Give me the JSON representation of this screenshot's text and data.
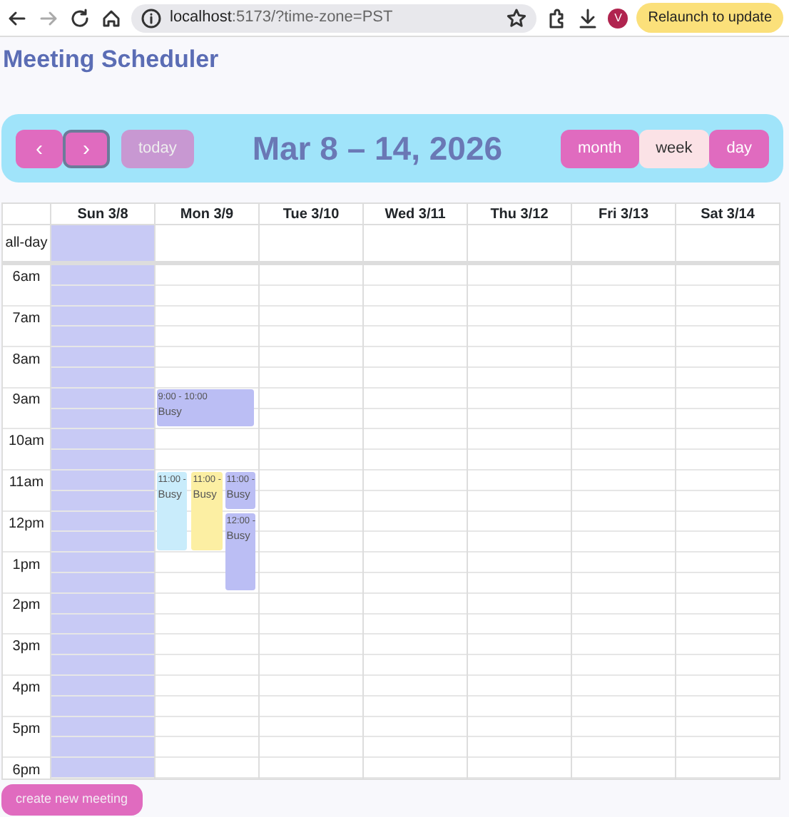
{
  "browser": {
    "url_host": "localhost",
    "url_rest": ":5173/?time-zone=PST",
    "relaunch": "Relaunch to update",
    "avatar": "V"
  },
  "app": {
    "title": "Meeting Scheduler"
  },
  "toolbar": {
    "nav": [
      {
        "label": "‹",
        "focused": false
      },
      {
        "label": "›",
        "focused": true
      }
    ],
    "today": {
      "label": "today",
      "disabled": true
    },
    "range": "Mar 8 – 14, 2026",
    "views": [
      {
        "label": "month",
        "selected": false
      },
      {
        "label": "week",
        "selected": true
      },
      {
        "label": "day",
        "selected": false
      }
    ]
  },
  "calendar": {
    "allday_label": "all-day",
    "hours": [
      "6am",
      "7am",
      "8am",
      "9am",
      "10am",
      "11am",
      "12pm",
      "1pm",
      "2pm",
      "3pm",
      "4pm",
      "5pm",
      "6pm"
    ],
    "days": [
      {
        "label": "Sun 3/8",
        "today": true
      },
      {
        "label": "Mon 3/9",
        "today": false,
        "events": [
          {
            "time": "9:00 - 10:00",
            "title": "Busy",
            "kind": "single",
            "color": "#bbbef4"
          },
          {
            "time": "11:00 -",
            "title": "Busy",
            "kind": "double",
            "color": "#c9ecfb"
          },
          {
            "time": "11:00 -",
            "title": "Busy",
            "kind": "double",
            "color": "#fcefa3"
          },
          {
            "time": "11:00 -",
            "title": "Busy",
            "kind": "single",
            "color": "#bbbef4"
          },
          {
            "time": "12:00 -",
            "title": "Busy",
            "kind": "double",
            "color": "#bbbef4"
          }
        ]
      },
      {
        "label": "Tue 3/10",
        "today": false
      },
      {
        "label": "Wed 3/11",
        "today": false
      },
      {
        "label": "Thu 3/12",
        "today": false
      },
      {
        "label": "Fri 3/13",
        "today": false
      },
      {
        "label": "Sat 3/14",
        "today": false
      }
    ]
  },
  "create_button": "create new meeting"
}
